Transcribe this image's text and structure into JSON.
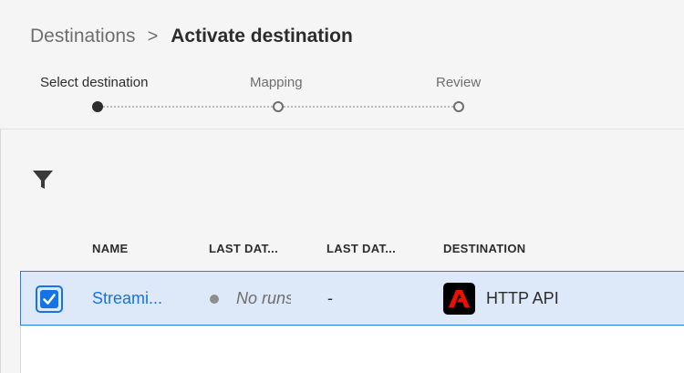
{
  "breadcrumb": {
    "parent": "Destinations",
    "separator": ">",
    "current": "Activate destination"
  },
  "steps": [
    {
      "label": "Select destination",
      "state": "active"
    },
    {
      "label": "Mapping",
      "state": "inactive"
    },
    {
      "label": "Review",
      "state": "inactive"
    }
  ],
  "toolbar": {
    "filter_icon": "filter-icon"
  },
  "table": {
    "columns": [
      "NAME",
      "LAST DAT...",
      "LAST DAT...",
      "DESTINATION"
    ],
    "rows": [
      {
        "selected": true,
        "name": "Streami...",
        "last_dataflow_status": "No runs",
        "last_dataflow_date": "-",
        "destination": "HTTP API",
        "destination_icon": "adobe-logo-icon"
      }
    ]
  },
  "colors": {
    "accent": "#1473e6",
    "selected_row": "#dde9f8",
    "background": "#f5f5f5",
    "logo_bg": "#000000",
    "logo_mark": "#eb1000"
  }
}
